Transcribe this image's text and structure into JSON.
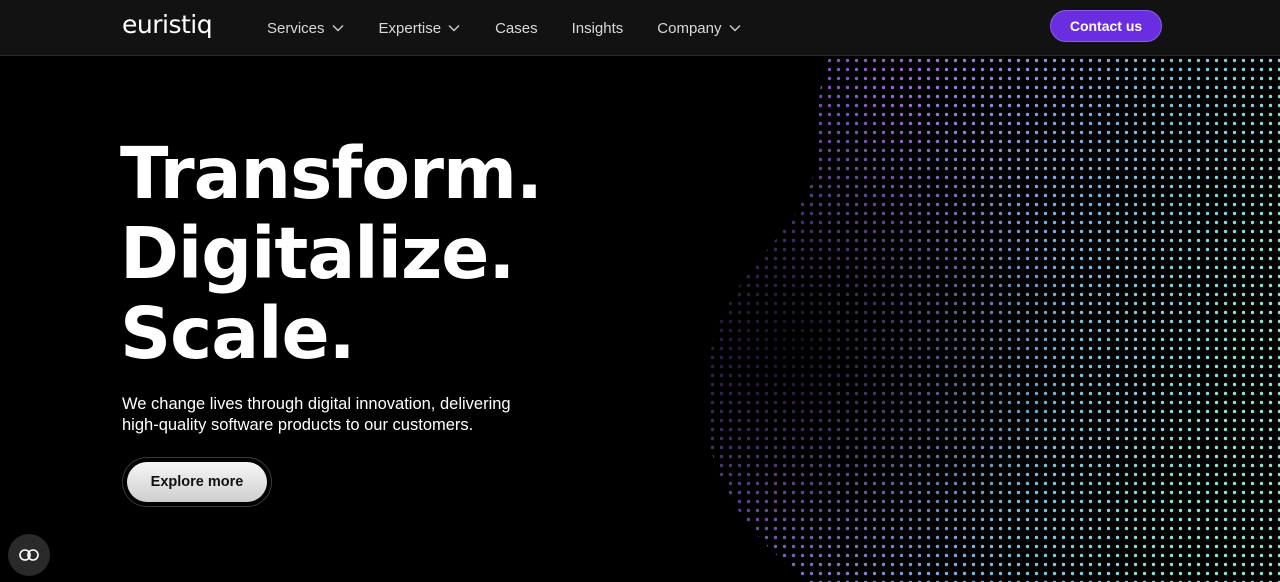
{
  "brand": {
    "logo_text": "euristiq"
  },
  "nav": {
    "items": [
      {
        "label": "Services",
        "has_dropdown": true
      },
      {
        "label": "Expertise",
        "has_dropdown": true
      },
      {
        "label": "Cases",
        "has_dropdown": false
      },
      {
        "label": "Insights",
        "has_dropdown": false
      },
      {
        "label": "Company",
        "has_dropdown": true
      }
    ],
    "contact_label": "Contact us"
  },
  "hero": {
    "headline": [
      "Transform.",
      "Digitalize.",
      "Scale."
    ],
    "subtitle": "We change lives through digital innovation, delivering high-quality software products to our customers.",
    "cta_label": "Explore more"
  },
  "icons": {
    "dropdown": "chevron-down-icon",
    "accessibility": "accessibility-toggle-icon"
  },
  "colors": {
    "background": "#000000",
    "nav_background": "#121212",
    "accent": "#6a2ee0",
    "sphere_purple": "#8a5cf0",
    "sphere_cyan": "#7fd6e0"
  }
}
